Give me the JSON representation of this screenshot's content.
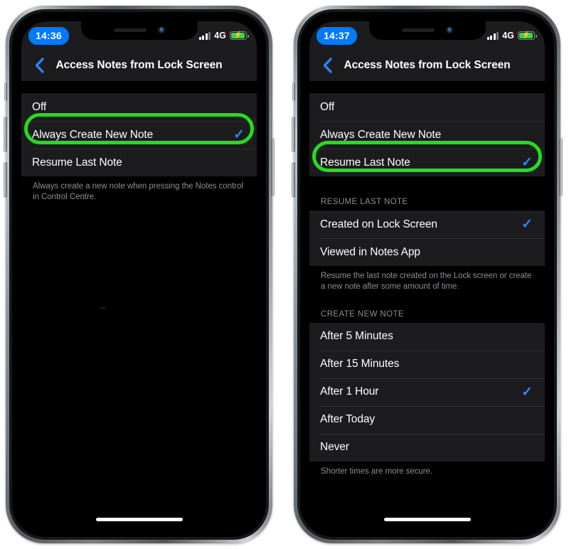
{
  "page": {
    "background": "#ffffff",
    "accent_blue": "#007aff",
    "check_blue": "#2f87f6",
    "highlight_green": "#24dd1f",
    "group_bg": "#1c1c1e",
    "screen_bg": "#000000"
  },
  "phones": [
    {
      "id": "phone-left",
      "status": {
        "time": "14:36",
        "network": "4G",
        "signal_icon": "signal-bars-icon",
        "battery_icon": "battery-charging-icon",
        "battery_level_percent": 80
      },
      "nav": {
        "back_icon": "chevron-left-icon",
        "title": "Access Notes from Lock Screen"
      },
      "groups": [
        {
          "header": "",
          "rows": [
            {
              "label": "Off",
              "checked": false,
              "highlighted": false
            },
            {
              "label": "Always Create New Note",
              "checked": true,
              "highlighted": true
            },
            {
              "label": "Resume Last Note",
              "checked": false,
              "highlighted": false
            }
          ],
          "footnote": "Always create a new note when pressing the Notes control in Control Centre."
        }
      ]
    },
    {
      "id": "phone-right",
      "status": {
        "time": "14:37",
        "network": "4G",
        "signal_icon": "signal-bars-icon",
        "battery_icon": "battery-charging-icon",
        "battery_level_percent": 80
      },
      "nav": {
        "back_icon": "chevron-left-icon",
        "title": "Access Notes from Lock Screen"
      },
      "groups": [
        {
          "header": "",
          "rows": [
            {
              "label": "Off",
              "checked": false,
              "highlighted": false
            },
            {
              "label": "Always Create New Note",
              "checked": false,
              "highlighted": false
            },
            {
              "label": "Resume Last Note",
              "checked": true,
              "highlighted": true
            }
          ],
          "footnote": ""
        },
        {
          "header": "RESUME LAST NOTE",
          "rows": [
            {
              "label": "Created on Lock Screen",
              "checked": true,
              "highlighted": false
            },
            {
              "label": "Viewed in Notes App",
              "checked": false,
              "highlighted": false
            }
          ],
          "footnote": "Resume the last note created on the Lock screen or create a new note after some amount of time."
        },
        {
          "header": "CREATE NEW NOTE",
          "rows": [
            {
              "label": "After 5 Minutes",
              "checked": false,
              "highlighted": false
            },
            {
              "label": "After 15 Minutes",
              "checked": false,
              "highlighted": false
            },
            {
              "label": "After 1 Hour",
              "checked": true,
              "highlighted": false
            },
            {
              "label": "After Today",
              "checked": false,
              "highlighted": false
            },
            {
              "label": "Never",
              "checked": false,
              "highlighted": false
            }
          ],
          "footnote": "Shorter times are more secure."
        }
      ]
    }
  ],
  "checkmark_glyph": "✓",
  "bolt_glyph": "⚡"
}
